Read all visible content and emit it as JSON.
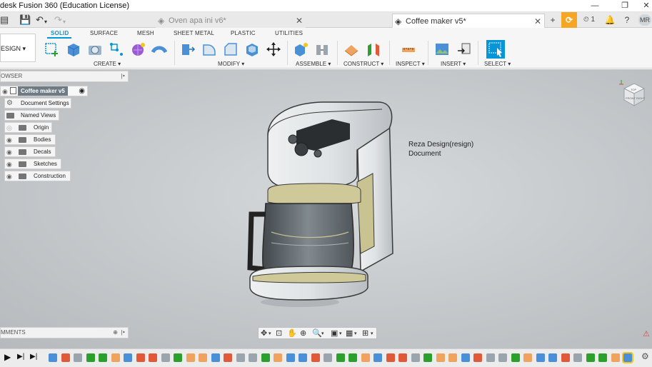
{
  "window": {
    "title": "desk Fusion 360 (Education License)",
    "controls": [
      "—",
      "❐",
      "✕"
    ]
  },
  "tabs": [
    {
      "label": "Oven apa ini v6*",
      "close": "✕"
    },
    {
      "label": "Coffee maker v5*",
      "close": "✕"
    }
  ],
  "tabbar": {
    "plus": "+",
    "extensions": "⟳",
    "jobs": "1",
    "notifications": "🔔",
    "help": "?",
    "avatar": "MR"
  },
  "ribbon": {
    "workspace": "ESIGN ▾",
    "tabs": [
      "SOLID",
      "SURFACE",
      "MESH",
      "SHEET METAL",
      "PLASTIC",
      "UTILITIES"
    ],
    "groups": [
      "CREATE ▾",
      "MODIFY ▾",
      "ASSEMBLE ▾",
      "CONSTRUCT ▾",
      "INSPECT ▾",
      "INSERT ▾",
      "SELECT ▾"
    ]
  },
  "browser": {
    "header": "OWSER",
    "root": "Coffee maker v5",
    "items": [
      {
        "label": "Document Settings",
        "icon": "gear-icon"
      },
      {
        "label": "Named Views",
        "icon": "folder-icon"
      },
      {
        "label": "Origin",
        "icon": "folder-icon"
      },
      {
        "label": "Bodies",
        "icon": "folder-icon"
      },
      {
        "label": "Decals",
        "icon": "folder-icon"
      },
      {
        "label": "Sketches",
        "icon": "folder-icon"
      },
      {
        "label": "Construction",
        "icon": "folder-icon"
      }
    ]
  },
  "comments": {
    "label": "MMENTS"
  },
  "annotation": {
    "line1": "Reza Design(resign)",
    "line2": "Document"
  },
  "viewcube": {
    "top": "TOP",
    "front": "FRONT",
    "right": "RIGHT"
  },
  "colors": {
    "accent": "#0696d7",
    "ribbon_bg": "#f6f6f6",
    "viewport": "#c4c8cb",
    "orange": "#f5a623"
  }
}
